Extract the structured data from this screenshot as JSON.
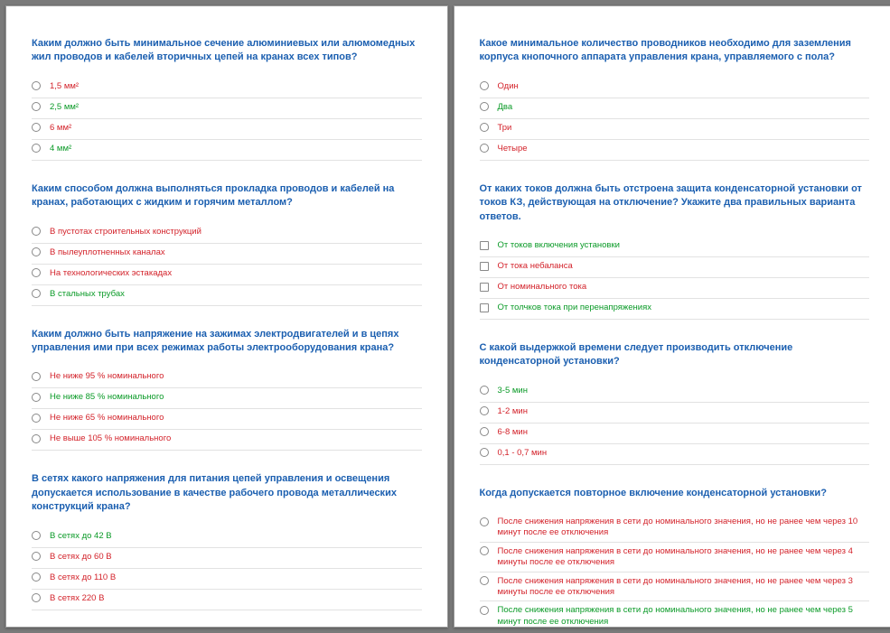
{
  "colors": {
    "green": "#0a9a27",
    "red": "#d3222a",
    "title_blue": "#1b5fb0"
  },
  "pages": [
    {
      "questions": [
        {
          "title": "Каким должно быть минимальное сечение алюминиевых или алюмомедных жил проводов и кабелей вторичных цепей на кранах всех типов?",
          "control": "radio",
          "options": [
            {
              "text": "1,5 мм²",
              "cls": "red"
            },
            {
              "text": "2,5 мм²",
              "cls": "green"
            },
            {
              "text": "6 мм²",
              "cls": "red"
            },
            {
              "text": "4 мм²",
              "cls": "green"
            }
          ]
        },
        {
          "title": "Каким способом должна выполняться прокладка проводов и кабелей на кранах, работающих с жидким и горячим металлом?",
          "control": "radio",
          "options": [
            {
              "text": "В пустотах строительных конструкций",
              "cls": "red"
            },
            {
              "text": "В пылеуплотненных каналах",
              "cls": "red"
            },
            {
              "text": "На технологических эстакадах",
              "cls": "red"
            },
            {
              "text": "В стальных трубах",
              "cls": "green"
            }
          ]
        },
        {
          "title": "Каким должно быть напряжение на зажимах электродвигателей и в цепях управления ими при всех режимах работы электрооборудования крана?",
          "control": "radio",
          "options": [
            {
              "text": "Не ниже 95 % номинального",
              "cls": "red"
            },
            {
              "text": "Не ниже 85 % номинального",
              "cls": "green"
            },
            {
              "text": "Не ниже 65 % номинального",
              "cls": "red"
            },
            {
              "text": "Не выше 105 % номинального",
              "cls": "red"
            }
          ]
        },
        {
          "title": "В сетях какого напряжения для питания цепей управления и освещения допускается использование в качестве рабочего провода металлических конструкций крана?",
          "control": "radio",
          "options": [
            {
              "text": "В сетях до 42 В",
              "cls": "green"
            },
            {
              "text": "В сетях до 60 В",
              "cls": "red"
            },
            {
              "text": "В сетях до 110 В",
              "cls": "red"
            },
            {
              "text": "В сетях 220 В",
              "cls": "red"
            }
          ]
        }
      ]
    },
    {
      "questions": [
        {
          "title": "Какое минимальное количество проводников необходимо для заземления корпуса кнопочного аппарата управления крана, управляемого с пола?",
          "control": "radio",
          "options": [
            {
              "text": "Один",
              "cls": "red"
            },
            {
              "text": "Два",
              "cls": "green"
            },
            {
              "text": "Три",
              "cls": "red"
            },
            {
              "text": "Четыре",
              "cls": "red"
            }
          ]
        },
        {
          "title": "От каких токов должна быть отстроена защита конденсаторной установки от токов КЗ, действующая на отключение? Укажите два правильных варианта ответов.",
          "control": "checkbox",
          "options": [
            {
              "text": "От токов включения установки",
              "cls": "green"
            },
            {
              "text": "От тока небаланса",
              "cls": "red"
            },
            {
              "text": "От номинального тока",
              "cls": "red"
            },
            {
              "text": "От толчков тока при перенапряжениях",
              "cls": "green"
            }
          ]
        },
        {
          "title": "С какой выдержкой времени следует производить отключение конденсаторной установки?",
          "control": "radio",
          "options": [
            {
              "text": "3-5 мин",
              "cls": "green"
            },
            {
              "text": "1-2 мин",
              "cls": "red"
            },
            {
              "text": "6-8 мин",
              "cls": "red"
            },
            {
              "text": "0,1 - 0,7 мин",
              "cls": "red"
            }
          ]
        },
        {
          "title": "Когда допускается повторное включение конденсаторной установки?",
          "control": "radio",
          "options": [
            {
              "text": "После снижения напряжения в сети до номинального значения, но не ранее чем через 10 минут после ее отключения",
              "cls": "red"
            },
            {
              "text": "После снижения напряжения в сети до номинального значения, но не ранее чем через 4 минуты после ее отключения",
              "cls": "red"
            },
            {
              "text": "После снижения напряжения в сети до номинального значения, но не ранее чем через 3 минуты после ее отключения",
              "cls": "red"
            },
            {
              "text": "После снижения напряжения в сети до номинального значения, но не ранее чем через 5 минут после ее отключения",
              "cls": "green"
            }
          ]
        }
      ]
    }
  ]
}
